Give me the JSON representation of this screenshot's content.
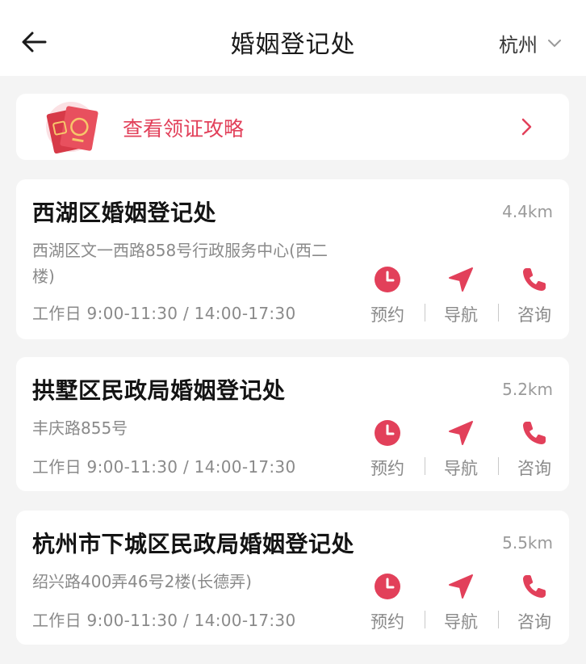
{
  "header": {
    "title": "婚姻登记处",
    "city": "杭州"
  },
  "guide": {
    "label": "查看领证攻略"
  },
  "actions": {
    "book": "预约",
    "navigate": "导航",
    "consult": "咨询"
  },
  "colors": {
    "accent": "#e2405a",
    "background": "#f4f4f4",
    "card": "#ffffff",
    "muted_text": "#8a8a8a"
  },
  "offices": [
    {
      "name": "西湖区婚姻登记处",
      "distance": "4.4km",
      "address": "西湖区文一西路858号行政服务中心(西二楼)",
      "hours": "工作日 9:00-11:30  / 14:00-17:30"
    },
    {
      "name": "拱墅区民政局婚姻登记处",
      "distance": "5.2km",
      "address": "丰庆路855号",
      "hours": "工作日 9:00-11:30  / 14:00-17:30"
    },
    {
      "name": "杭州市下城区民政局婚姻登记处",
      "distance": "5.5km",
      "address": "绍兴路400弄46号2楼(长德弄)",
      "hours": "工作日 9:00-11:30  / 14:00-17:30"
    }
  ]
}
